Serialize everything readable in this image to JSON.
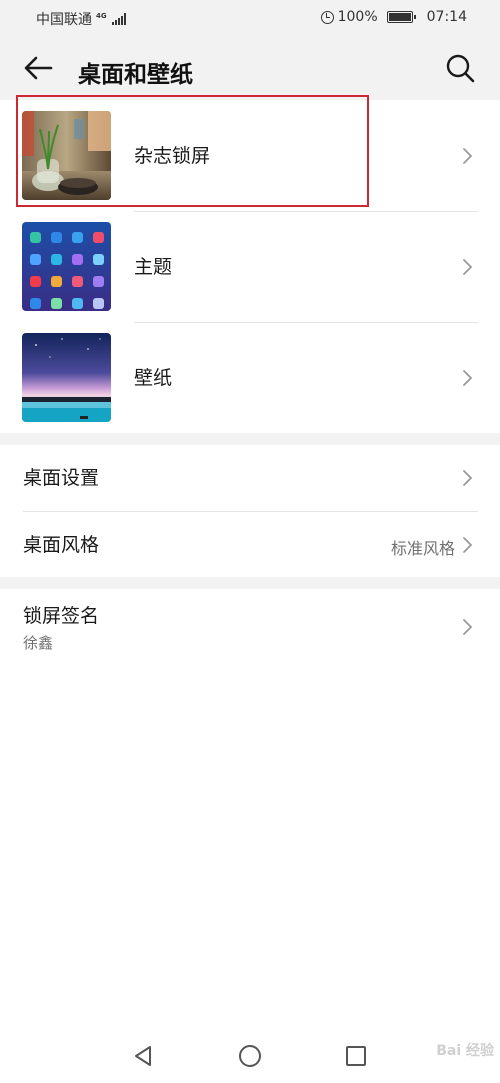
{
  "status_bar": {
    "carrier": "中国联通",
    "network": "4G",
    "battery": "100%",
    "battery_level": 1.0,
    "time": "07:14"
  },
  "app_bar": {
    "back_icon": "arrow-left-icon",
    "title": "桌面和壁纸",
    "search_icon": "search-icon"
  },
  "thumb_items": [
    {
      "label": "杂志锁屏",
      "thumbnail": "magazine-lockscreen-photo",
      "highlighted": true
    },
    {
      "label": "主题",
      "thumbnail": "theme-preview"
    },
    {
      "label": "壁纸",
      "thumbnail": "wallpaper-sunset-sea"
    }
  ],
  "settings": [
    {
      "label": "桌面设置"
    },
    {
      "label": "桌面风格",
      "value": "标准风格"
    }
  ],
  "signature": {
    "label": "锁屏签名",
    "value": "徐鑫"
  },
  "nav_bar": {
    "back_icon": "triangle-back-icon",
    "home_icon": "circle-home-icon",
    "recents_icon": "square-recents-icon"
  },
  "watermark": "Bai 经验",
  "colors": {
    "background": "#f2f2f2",
    "highlight_border": "#cc2a33",
    "secondary_text": "#707070"
  }
}
